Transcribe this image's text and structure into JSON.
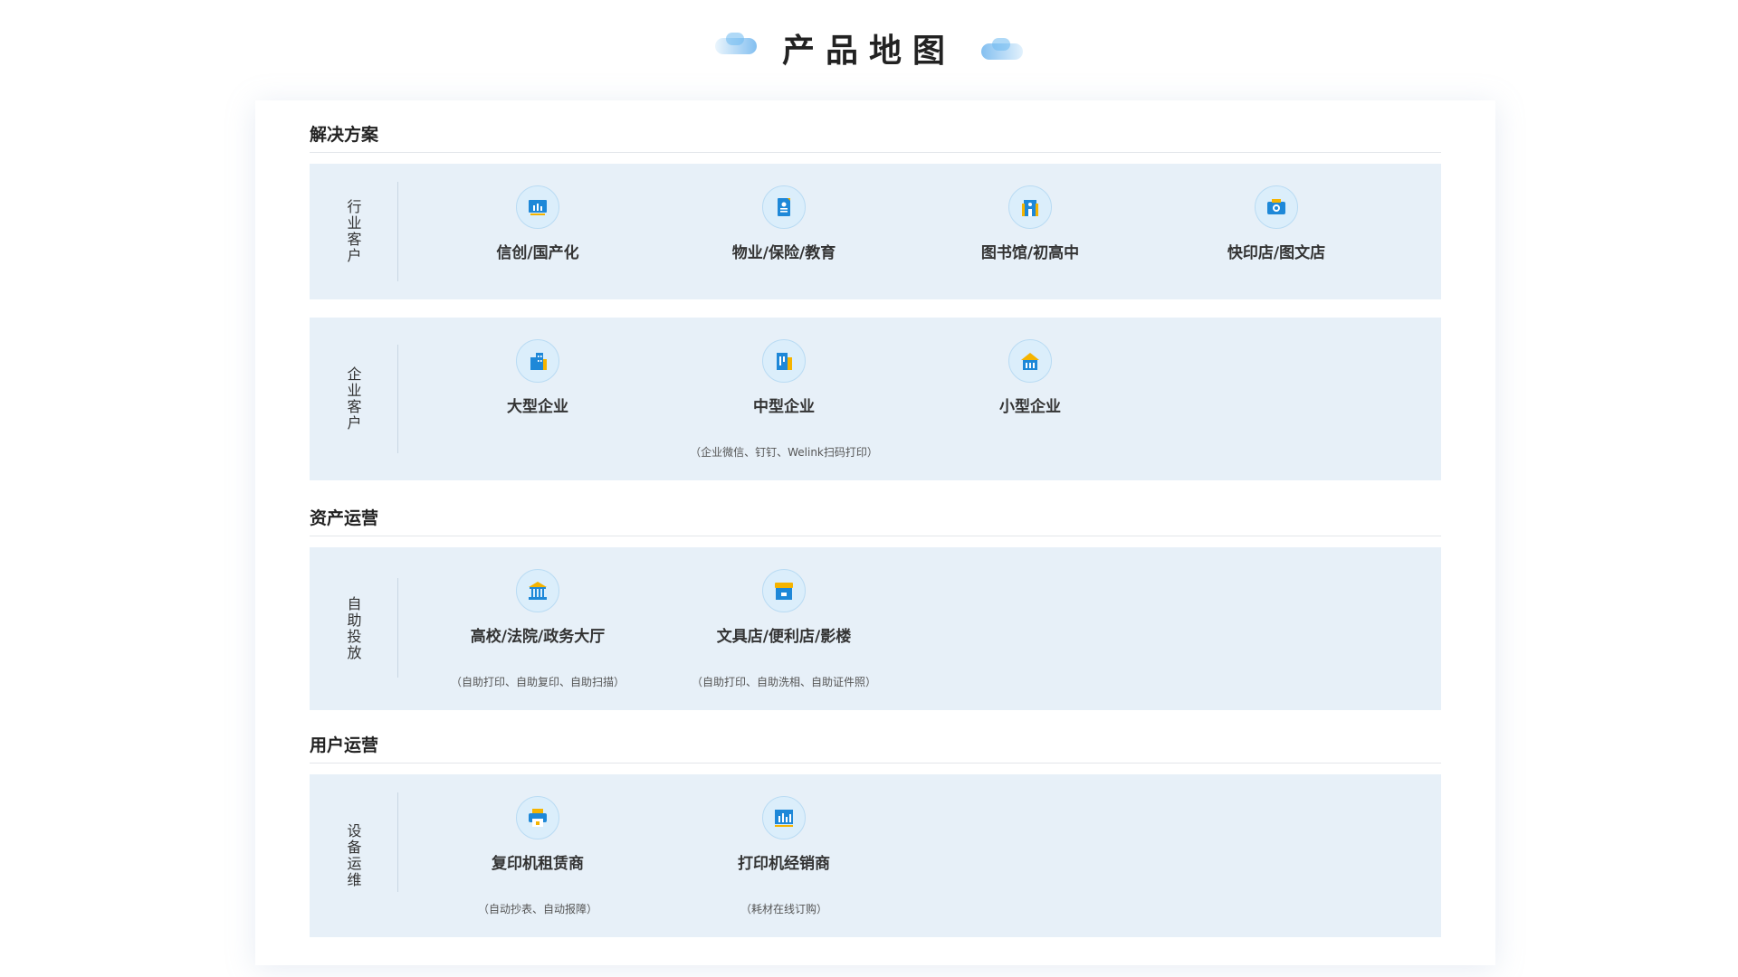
{
  "page_title": "产品地图",
  "sections": [
    {
      "title": "解决方案"
    },
    {
      "title": "资产运营"
    },
    {
      "title": "用户运营"
    }
  ],
  "panels": [
    {
      "label": "行业客户",
      "items": [
        {
          "label": "信创/国产化",
          "icon": "chart-board-icon"
        },
        {
          "label": "物业/保险/教育",
          "icon": "document-icon"
        },
        {
          "label": "图书馆/初高中",
          "icon": "building-icon"
        },
        {
          "label": "快印店/图文店",
          "icon": "camera-icon"
        }
      ]
    },
    {
      "label": "企业客户",
      "items": [
        {
          "label": "大型企业",
          "icon": "city-buildings-icon"
        },
        {
          "label": "中型企业",
          "icon": "office-building-icon",
          "note": "（企业微信、钉钉、Welink扫码打印）"
        },
        {
          "label": "小型企业",
          "icon": "small-house-icon"
        }
      ]
    },
    {
      "label": "自助投放",
      "items": [
        {
          "label": "高校/法院/政务大厅",
          "icon": "government-hall-icon",
          "note": "（自助打印、自助复印、自助扫描）"
        },
        {
          "label": "文具店/便利店/影楼",
          "icon": "shop-icon",
          "note": "（自助打印、自助洗相、自助证件照）"
        }
      ]
    },
    {
      "label": "设备运维",
      "items": [
        {
          "label": "复印机租赁商",
          "icon": "printer-icon",
          "note": "（自动抄表、自动报障）"
        },
        {
          "label": "打印机经销商",
          "icon": "bar-chart-icon",
          "note": "（耗材在线订购）"
        }
      ]
    }
  ],
  "colors": {
    "accent_blue": "#1e88d8",
    "accent_yellow": "#f5b400",
    "panel_bg": "#e7f0f8"
  }
}
